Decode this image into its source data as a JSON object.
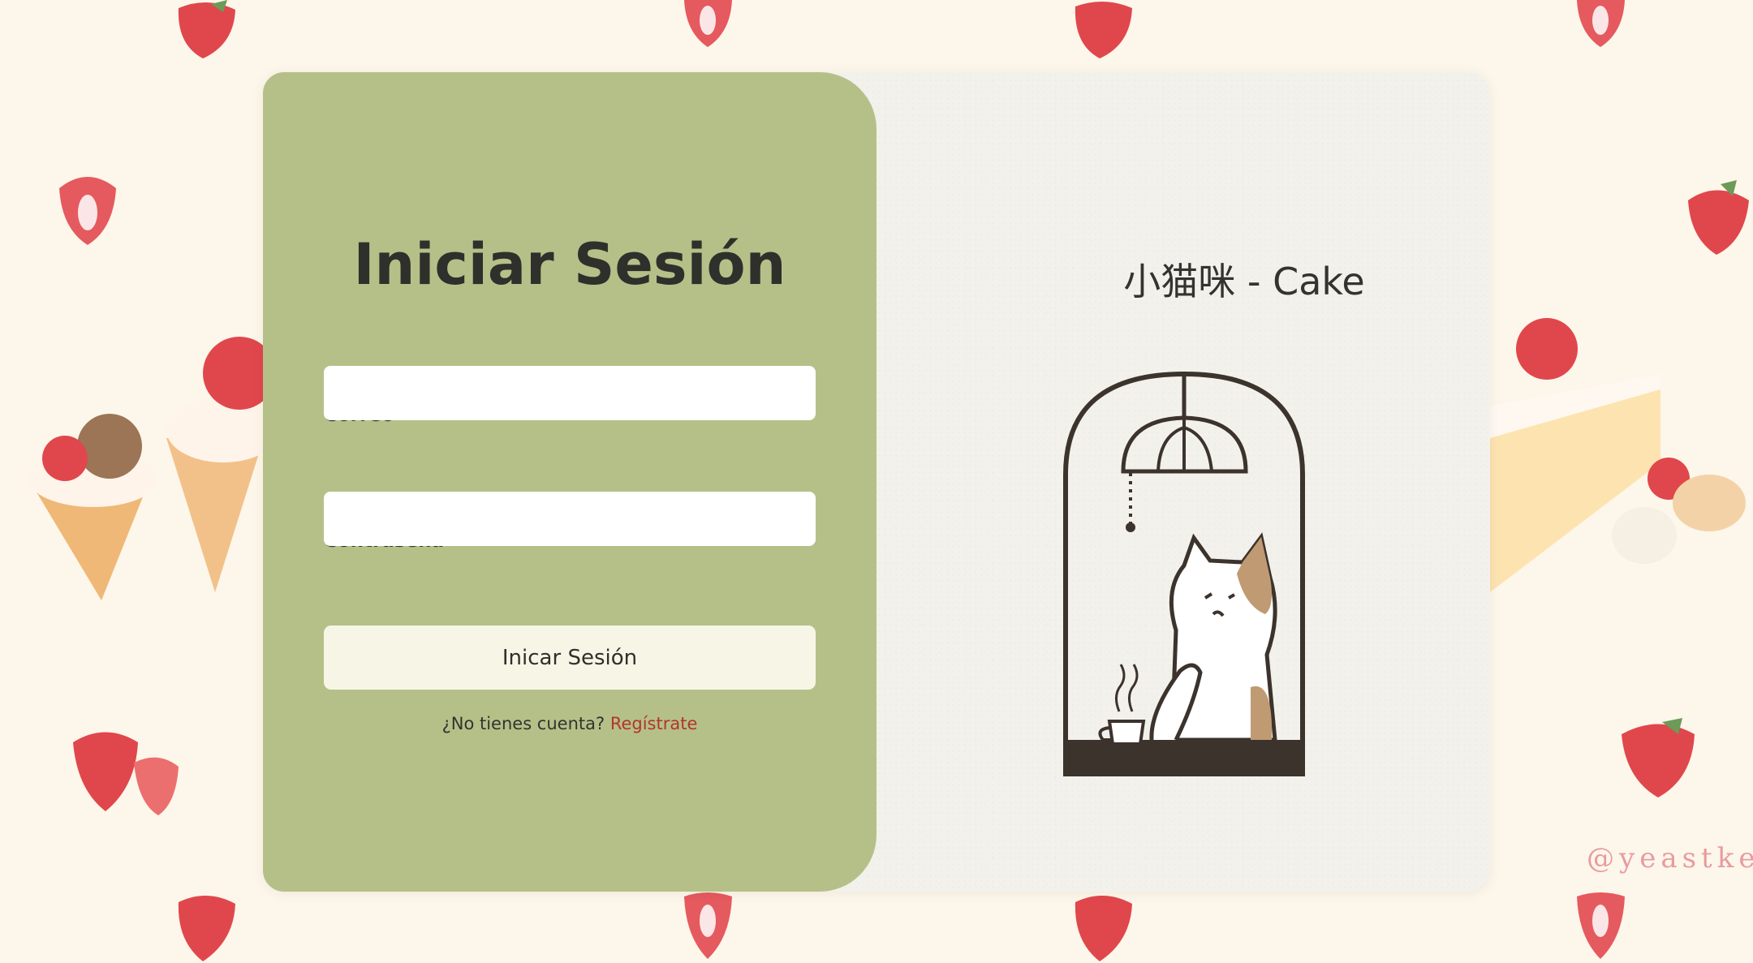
{
  "login": {
    "title": "Iniciar Sesión",
    "email_label": "Correo",
    "email_value": "",
    "password_label": "Contraseña",
    "password_value": "",
    "submit_label": "Inicar Sesión",
    "register_prompt": "¿No tienes cuenta?",
    "register_link": "Regístrate"
  },
  "brand": {
    "name": "小猫咪 - Cake"
  },
  "background": {
    "watermark": "@yeastke"
  },
  "colors": {
    "panel": "#b5c088",
    "card": "#f3f1ec",
    "page_bg": "#fdf6ea",
    "button": "#f7f6e6",
    "link": "#b1362c",
    "text": "#2f2f2c"
  },
  "icons": [
    "strawberry-icon",
    "cat-illustration",
    "lamp-icon",
    "coffee-cup-icon"
  ]
}
